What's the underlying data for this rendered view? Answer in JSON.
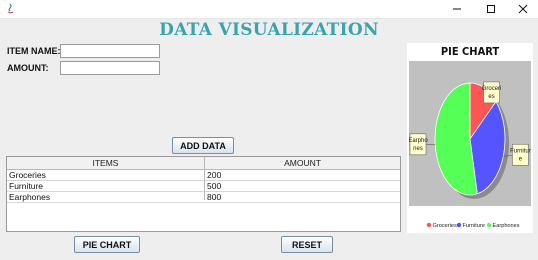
{
  "app": {
    "title": "DATA VISUALIZATION",
    "minimize_icon": "minimize-icon",
    "maximize_icon": "maximize-icon",
    "close_icon": "close-icon",
    "accent_color": "#3aa3ad"
  },
  "form": {
    "item_name_label": "ITEM NAME:",
    "item_name_value": "",
    "amount_label": "AMOUNT:",
    "amount_value": "",
    "add_button": "ADD DATA"
  },
  "table": {
    "columns": [
      "ITEMS",
      "AMOUNT"
    ],
    "rows": [
      [
        "Groceries",
        "200"
      ],
      [
        "Furniture",
        "500"
      ],
      [
        "Earphones",
        "800"
      ]
    ]
  },
  "buttons": {
    "pie_chart": "PIE CHART",
    "reset": "RESET"
  },
  "chart_data": {
    "type": "pie",
    "title": "PIE CHART",
    "categories": [
      "Groceries",
      "Furniture",
      "Earphones"
    ],
    "values": [
      200,
      500,
      800
    ],
    "colors": [
      "#ff5555",
      "#5555ff",
      "#55ff55"
    ],
    "slice_labels": [
      "Groceri es",
      "Furnitur e",
      "Earpho nes"
    ],
    "legend": [
      "Groceries",
      "Furniture",
      "Earphones"
    ],
    "legend_position": "bottom"
  }
}
